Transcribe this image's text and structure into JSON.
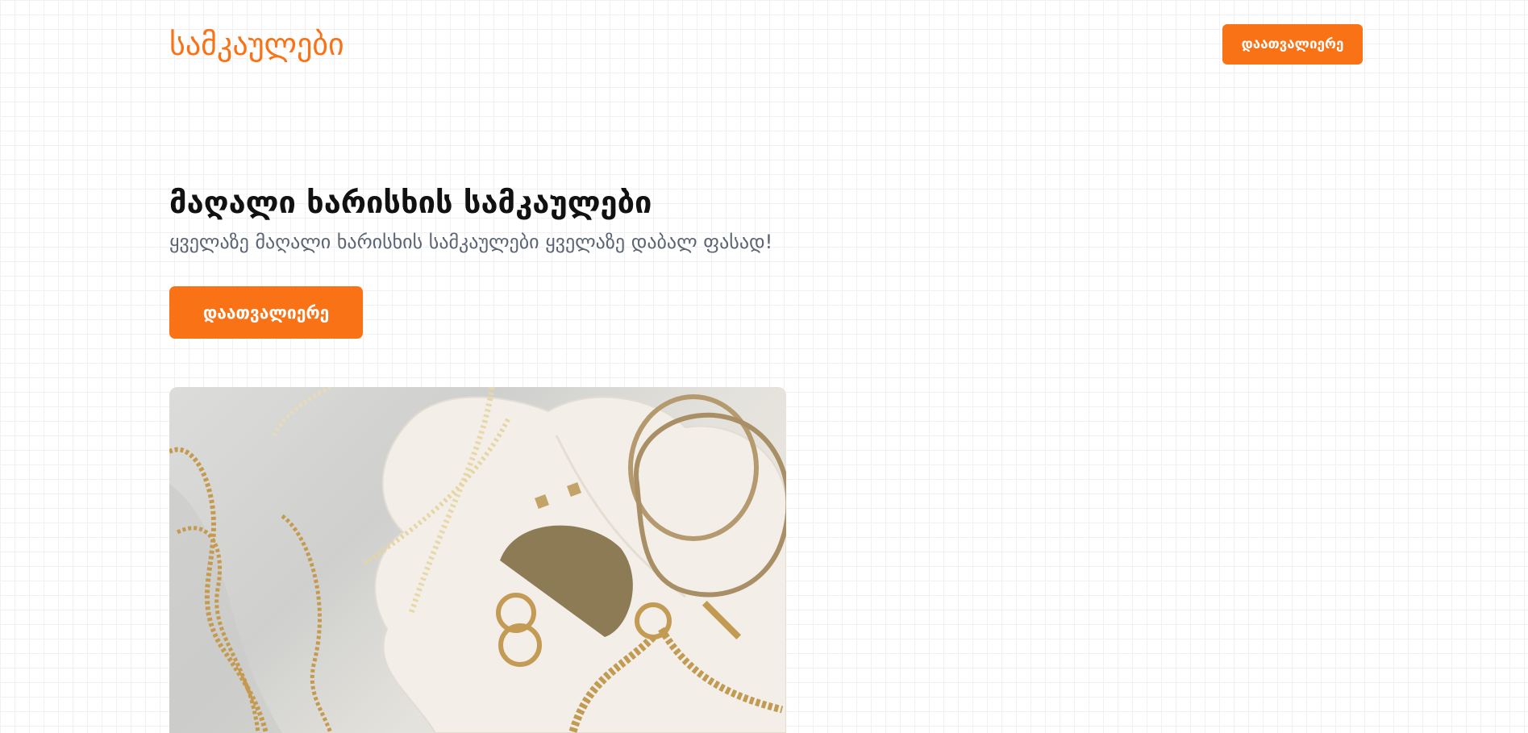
{
  "header": {
    "logo": "სამკაულები",
    "nav_button_label": "დაათვალიერე"
  },
  "hero": {
    "title": "მაღალი ხარისხის სამკაულები",
    "subtitle": "ყველაზე მაღალი ხარისხის სამკაულები ყველაზე დაბალ ფასად!",
    "cta_label": "დაათვალიერე"
  },
  "colors": {
    "accent": "#f97316",
    "title": "#111111",
    "subtitle": "#5b6472"
  }
}
